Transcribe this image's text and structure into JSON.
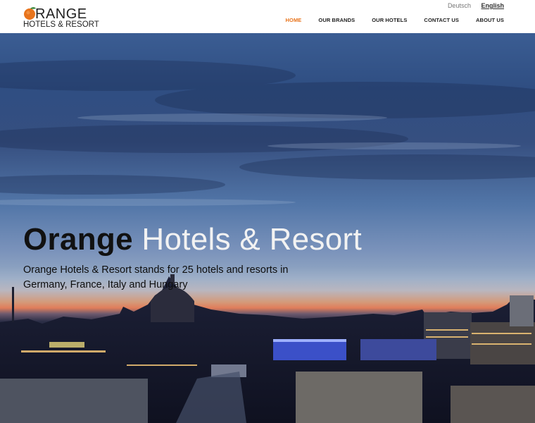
{
  "brand": {
    "word": "RANGE",
    "sub": "HOTELS & RESORT",
    "colors": {
      "orange": "#e8741c",
      "leaf": "#3c8a3c"
    }
  },
  "languages": [
    {
      "label": "Deutsch",
      "active": false
    },
    {
      "label": "English",
      "active": true
    }
  ],
  "nav": [
    {
      "label": "HOME",
      "current": true
    },
    {
      "label": "OUR BRANDS",
      "current": false
    },
    {
      "label": "OUR HOTELS",
      "current": false
    },
    {
      "label": "CONTACT US",
      "current": false
    },
    {
      "label": "ABOUT US",
      "current": false
    }
  ],
  "hero": {
    "title_strong": "Orange",
    "title_light": "Hotels & Resort",
    "text": "Orange Hotels & Resort stands for 25 hotels and resorts in Germany, France, Italy and Hungary",
    "image": "berlin-skyline-dusk"
  }
}
